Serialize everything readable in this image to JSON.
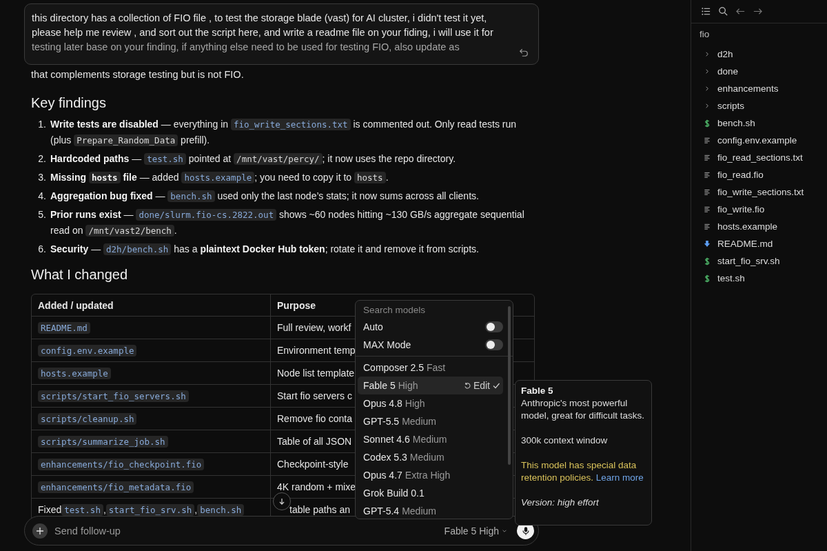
{
  "prompt": {
    "lines": [
      "this directory has a collection of FIO file , to test the storage blade (vast) for AI cluster, i didn't test it yet,",
      "please help me review , and sort out the script here, and write a readme file on your fiding, i will use it for",
      "testing later base on your finding, if anything else need to be  used for testing FIO, also update as"
    ]
  },
  "intro_tail": "that complements storage testing but is not FIO.",
  "findings_heading": "Key findings",
  "findings": [
    {
      "number": "1.",
      "parts": [
        {
          "kind": "bold",
          "text": "Write tests are disabled"
        },
        {
          "kind": "text",
          "text": " — everything in "
        },
        {
          "kind": "link_code",
          "text": "fio_write_sections.txt"
        },
        {
          "kind": "text",
          "text": " is commented out. Only read tests run (plus "
        },
        {
          "kind": "code",
          "text": "Prepare_Random_Data"
        },
        {
          "kind": "text",
          "text": " prefill)."
        }
      ]
    },
    {
      "number": "2.",
      "parts": [
        {
          "kind": "bold",
          "text": "Hardcoded paths"
        },
        {
          "kind": "text",
          "text": " — "
        },
        {
          "kind": "link_code",
          "text": "test.sh"
        },
        {
          "kind": "text",
          "text": " pointed at "
        },
        {
          "kind": "code",
          "text": "/mnt/vast/percy/"
        },
        {
          "kind": "text",
          "text": "; it now uses the repo directory."
        }
      ]
    },
    {
      "number": "3.",
      "parts": [
        {
          "kind": "bold",
          "text": "Missing "
        },
        {
          "kind": "bold_code",
          "text": "hosts"
        },
        {
          "kind": "bold",
          "text": " file"
        },
        {
          "kind": "text",
          "text": " — added "
        },
        {
          "kind": "link_code",
          "text": "hosts.example"
        },
        {
          "kind": "text",
          "text": "; you need to copy it to "
        },
        {
          "kind": "code",
          "text": "hosts"
        },
        {
          "kind": "text",
          "text": "."
        }
      ]
    },
    {
      "number": "4.",
      "parts": [
        {
          "kind": "bold",
          "text": "Aggregation bug fixed"
        },
        {
          "kind": "text",
          "text": " — "
        },
        {
          "kind": "link_code",
          "text": "bench.sh"
        },
        {
          "kind": "text",
          "text": " used only the last node’s stats; it now sums across all clients."
        }
      ]
    },
    {
      "number": "5.",
      "parts": [
        {
          "kind": "bold",
          "text": "Prior runs exist"
        },
        {
          "kind": "text",
          "text": " — "
        },
        {
          "kind": "link_code",
          "text": "done/slurm.fio-cs.2822.out"
        },
        {
          "kind": "text",
          "text": " shows ~60 nodes hitting ~130 GB/s aggregate sequential read on "
        },
        {
          "kind": "code",
          "text": "/mnt/vast2/bench"
        },
        {
          "kind": "text",
          "text": "."
        }
      ]
    },
    {
      "number": "6.",
      "parts": [
        {
          "kind": "bold",
          "text": "Security"
        },
        {
          "kind": "text",
          "text": " — "
        },
        {
          "kind": "link_code",
          "text": "d2h/bench.sh"
        },
        {
          "kind": "text",
          "text": " has a "
        },
        {
          "kind": "bold",
          "text": "plaintext Docker Hub token"
        },
        {
          "kind": "text",
          "text": "; rotate it and remove it from scripts."
        }
      ]
    }
  ],
  "changes_heading": "What I changed",
  "table": {
    "columns": [
      "Added / updated",
      "Purpose"
    ],
    "rows": [
      {
        "item": [
          {
            "kind": "link_code",
            "text": "README.md"
          }
        ],
        "purpose": "Full review, workf"
      },
      {
        "item": [
          {
            "kind": "link_code",
            "text": "config.env.example"
          }
        ],
        "purpose": "Environment temp"
      },
      {
        "item": [
          {
            "kind": "link_code",
            "text": "hosts.example"
          }
        ],
        "purpose": "Node list template"
      },
      {
        "item": [
          {
            "kind": "link_code",
            "text": "scripts/start_fio_servers.sh"
          }
        ],
        "purpose": "Start fio servers c"
      },
      {
        "item": [
          {
            "kind": "link_code",
            "text": "scripts/cleanup.sh"
          }
        ],
        "purpose": "Remove fio conta"
      },
      {
        "item": [
          {
            "kind": "link_code",
            "text": "scripts/summarize_job.sh"
          }
        ],
        "purpose": "Table of all JSON"
      },
      {
        "item": [
          {
            "kind": "link_code",
            "text": "enhancements/fio_checkpoint.fio"
          }
        ],
        "purpose": "Checkpoint-style"
      },
      {
        "item": [
          {
            "kind": "link_code",
            "text": "enhancements/fio_metadata.fio"
          }
        ],
        "purpose": "4K random + mixe"
      },
      {
        "item": [
          {
            "kind": "text",
            "text": "Fixed "
          },
          {
            "kind": "link_code",
            "text": "test.sh"
          },
          {
            "kind": "text",
            "text": ", "
          },
          {
            "kind": "link_code",
            "text": "start_fio_srv.sh"
          },
          {
            "kind": "text",
            "text": ", "
          },
          {
            "kind": "link_code",
            "text": "bench.sh"
          }
        ],
        "purpose": "table paths an"
      }
    ]
  },
  "composer": {
    "placeholder": "Send follow-up",
    "model": "Fable 5 High"
  },
  "model_menu": {
    "search_placeholder": "Search models",
    "toggles": [
      {
        "label": "Auto",
        "on": false
      },
      {
        "label": "MAX Mode",
        "on": false
      }
    ],
    "models": [
      {
        "name": "Composer 2.5",
        "effort": "Fast",
        "selected": false
      },
      {
        "name": "Fable 5",
        "effort": "High",
        "selected": true,
        "edit": "Edit"
      },
      {
        "name": "Opus 4.8",
        "effort": "High",
        "selected": false
      },
      {
        "name": "GPT-5.5",
        "effort": "Medium",
        "selected": false
      },
      {
        "name": "Sonnet 4.6",
        "effort": "Medium",
        "selected": false
      },
      {
        "name": "Codex 5.3",
        "effort": "Medium",
        "selected": false
      },
      {
        "name": "Opus 4.7",
        "effort": "Extra High",
        "selected": false
      },
      {
        "name": "Grok Build 0.1",
        "selected": false
      },
      {
        "name": "GPT-5.4",
        "effort": "Medium",
        "selected": false
      }
    ]
  },
  "model_info": {
    "title": "Fable 5",
    "description": "Anthropic's most powerful model, great for difficult tasks.",
    "context": "300k context window",
    "warning": "This model has special data retention policies.",
    "link": "Learn more",
    "version": "Version: high effort"
  },
  "explorer": {
    "root": "fio",
    "items": [
      {
        "name": "d2h",
        "kind": "folder",
        "expanded": false
      },
      {
        "name": "done",
        "kind": "folder",
        "expanded": false
      },
      {
        "name": "enhancements",
        "kind": "folder",
        "expanded": false
      },
      {
        "name": "scripts",
        "kind": "folder",
        "expanded": false
      },
      {
        "name": "bench.sh",
        "kind": "shell"
      },
      {
        "name": "config.env.example",
        "kind": "text"
      },
      {
        "name": "fio_read_sections.txt",
        "kind": "text"
      },
      {
        "name": "fio_read.fio",
        "kind": "text"
      },
      {
        "name": "fio_write_sections.txt",
        "kind": "text"
      },
      {
        "name": "fio_write.fio",
        "kind": "text"
      },
      {
        "name": "hosts.example",
        "kind": "text"
      },
      {
        "name": "README.md",
        "kind": "markdown"
      },
      {
        "name": "start_fio_srv.sh",
        "kind": "shell"
      },
      {
        "name": "test.sh",
        "kind": "shell"
      }
    ]
  }
}
